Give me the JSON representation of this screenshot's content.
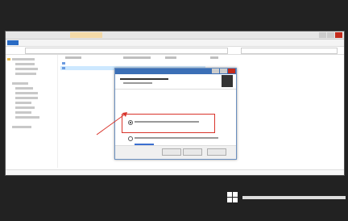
{
  "colors": {
    "desktop": "#222222",
    "ribbon_accent": "#2b6cc4",
    "context_tab": "#f3d9a7",
    "dialog_title": "#3b6fb6",
    "highlight": "#d9342b",
    "link": "#3b6fd0",
    "close_button": "#c42b1c"
  },
  "icons": [
    "folder-icon",
    "app-icon",
    "server-logo-icon",
    "windows-logo-icon"
  ],
  "dialog": {
    "option_count": 2,
    "selected_option": 1
  }
}
